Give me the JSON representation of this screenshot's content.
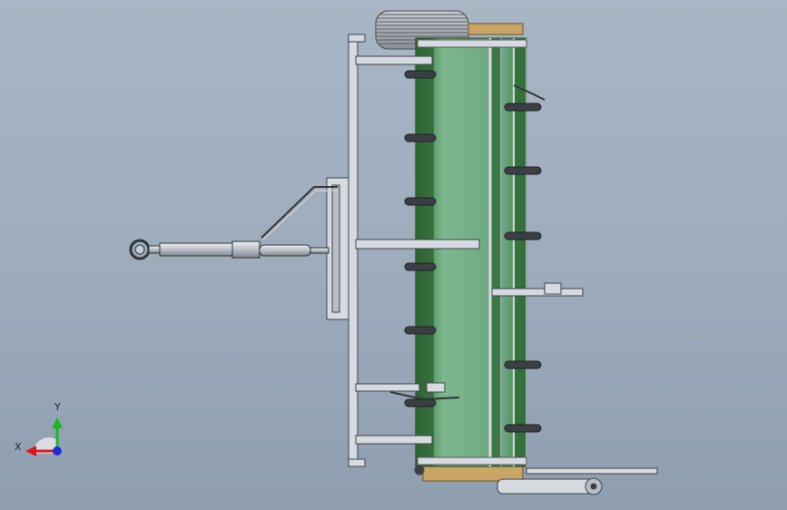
{
  "view": {
    "background_top": "#a9b6c5",
    "background_bottom": "#8f9eaf"
  },
  "model": {
    "panel_color": "#6ea984",
    "panel_dark": "#2d6230",
    "frame_color": "#d6dbe1",
    "wood_color": "#c9a668",
    "part_color": "#3a3f44"
  },
  "triad": {
    "x_label": "X",
    "y_label": "Y",
    "x_color": "#e0141e",
    "y_color": "#19b81f",
    "z_color": "#1f2bd6"
  }
}
